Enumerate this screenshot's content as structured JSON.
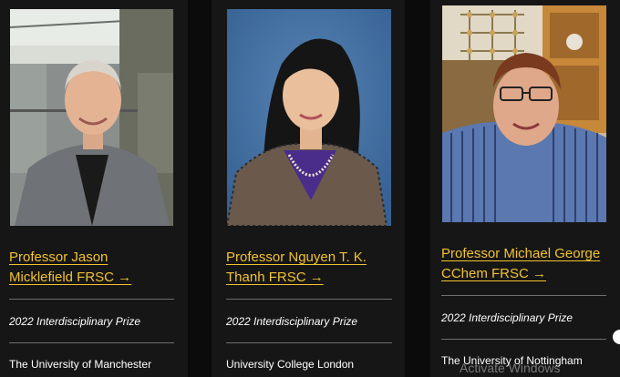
{
  "cards": [
    {
      "name_line1": "Professor Jason",
      "name_line2": "Micklefield FRSC →",
      "prize": "2022 Interdisciplinary Prize",
      "university": "The University of Manchester"
    },
    {
      "name_line1": "Professor Nguyen T. K.",
      "name_line2": "Thanh FRSC →",
      "prize": "2022 Interdisciplinary Prize",
      "university": "University College London"
    },
    {
      "name_line1": "Professor Michael George",
      "name_line2": "CChem FRSC →",
      "prize": "2022 Interdisciplinary Prize",
      "university": "The University of Nottingham"
    }
  ],
  "watermark": "Activate Windows",
  "colors": {
    "link": "#f2c230",
    "card_bg": "#161616",
    "page_bg": "#000000"
  }
}
